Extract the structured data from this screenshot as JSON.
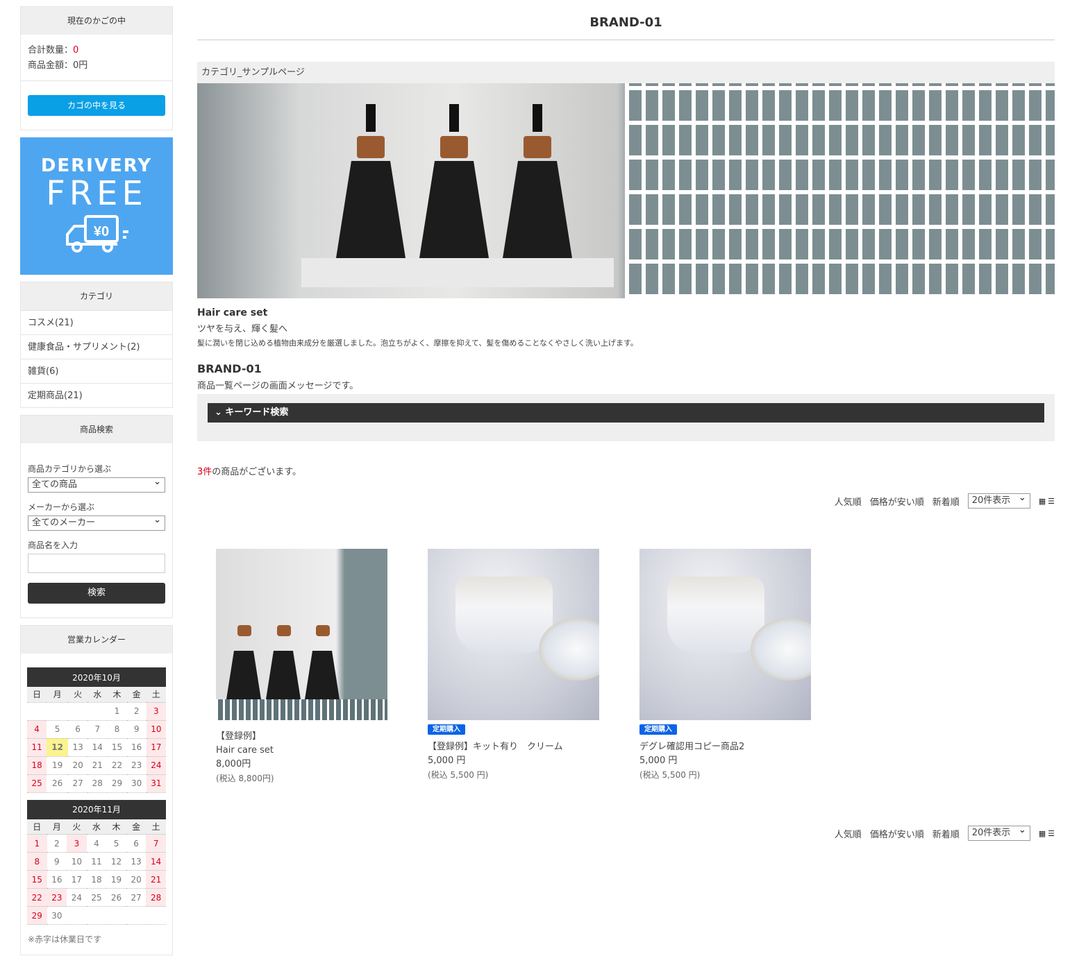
{
  "cart": {
    "title": "現在のかごの中",
    "qty_label": "合計数量：",
    "qty": "0",
    "price_label": "商品金額：",
    "price": "0円",
    "button": "カゴの中を見る"
  },
  "banner": {
    "line1": "DERIVERY",
    "line2": "FREE",
    "tag": "¥0"
  },
  "categories": {
    "title": "カテゴリ",
    "items": [
      "コスメ(21)",
      "健康食品・サプリメント(2)",
      "雑貨(6)",
      "定期商品(21)"
    ]
  },
  "search": {
    "title": "商品検索",
    "cat_label": "商品カテゴリから選ぶ",
    "cat_value": "全ての商品",
    "maker_label": "メーカーから選ぶ",
    "maker_value": "全てのメーカー",
    "name_label": "商品名を入力",
    "name_value": "",
    "button": "検索"
  },
  "calendar": {
    "title": "営業カレンダー",
    "weekdays": [
      "日",
      "月",
      "火",
      "水",
      "木",
      "金",
      "土"
    ],
    "months": [
      {
        "label": "2020年10月",
        "start": 4,
        "days": 31,
        "holidays": [
          3,
          4,
          10,
          11,
          17,
          18,
          24,
          25,
          31
        ],
        "today": 12
      },
      {
        "label": "2020年11月",
        "start": 0,
        "days": 30,
        "holidays": [
          1,
          3,
          7,
          8,
          14,
          15,
          21,
          22,
          23,
          28,
          29
        ]
      }
    ],
    "note": "※赤字は休業日です"
  },
  "main": {
    "title": "BRAND-01",
    "breadcrumb": "カテゴリ_サンプルページ",
    "hero_title": "Hair care set",
    "hero_sub": "ツヤを与え、輝く髪へ",
    "hero_desc": "髪に潤いを閉じ込める植物由来成分を厳選しました。泡立ちがよく、摩擦を抑えて、髪を傷めることなくやさしく洗い上げます。",
    "brand_heading": "BRAND-01",
    "brand_message": "商品一覧ページの画面メッセージです。",
    "keyword_search": "キーワード検索",
    "count": "3件",
    "count_suffix": "の商品がございます。"
  },
  "sort": {
    "popular": "人気順",
    "cheap": "価格が安い順",
    "new": "新着順",
    "per_page": "20件表示"
  },
  "products": [
    {
      "name1": "【登録例】",
      "name2": "Hair care set",
      "price": "8,000円",
      "tax": "(税込 8,800円)"
    },
    {
      "badge": "定期購入",
      "name1": "【登録例】キット有り　クリーム",
      "price": "5,000 円",
      "tax": "(税込 5,500 円)"
    },
    {
      "badge": "定期購入",
      "name1": "デグレ確認用コピー商品2",
      "price": "5,000 円",
      "tax": "(税込 5,500 円)"
    }
  ]
}
